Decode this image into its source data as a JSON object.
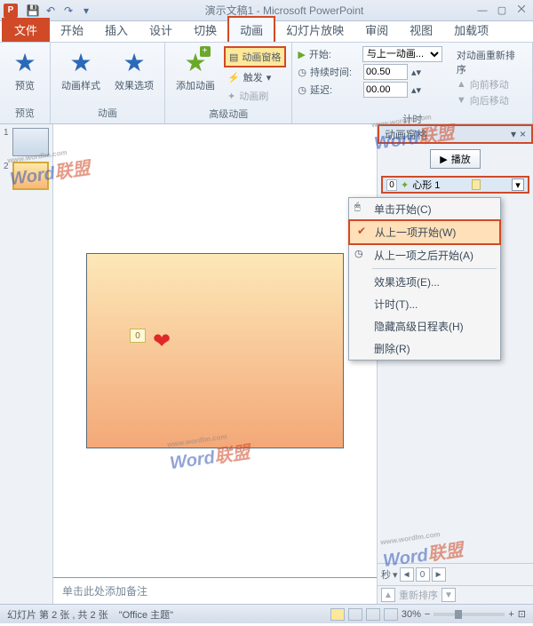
{
  "title": "演示文稿1 - Microsoft PowerPoint",
  "tabs": {
    "file": "文件",
    "home": "开始",
    "insert": "插入",
    "design": "设计",
    "transitions": "切换",
    "animations": "动画",
    "slideshow": "幻灯片放映",
    "review": "审阅",
    "view": "视图",
    "addins": "加载项"
  },
  "ribbon": {
    "preview": "预览",
    "anim_styles": "动画样式",
    "effect_opts": "效果选项",
    "add_anim": "添加动画",
    "anim_pane": "动画窗格",
    "trigger": "触发",
    "anim_painter": "动画刷",
    "start_label": "开始:",
    "start_value": "与上一动画...",
    "duration_label": "持续时间:",
    "duration_value": "00.50",
    "delay_label": "延迟:",
    "delay_value": "00.00",
    "reorder_title": "对动画重新排序",
    "move_earlier": "向前移动",
    "move_later": "向后移动",
    "g_preview": "预览",
    "g_anim": "动画",
    "g_advanced": "高级动画",
    "g_timing": "计时"
  },
  "pane": {
    "title": "动画窗格",
    "play": "播放",
    "item_num": "0",
    "item_name": "心形 1",
    "seconds": "秒",
    "reorder": "重新排序"
  },
  "menu": {
    "on_click": "单击开始(C)",
    "with_prev": "从上一项开始(W)",
    "after_prev": "从上一项之后开始(A)",
    "effect_opts": "效果选项(E)...",
    "timing": "计时(T)...",
    "hide_timeline": "隐藏高级日程表(H)",
    "remove": "删除(R)"
  },
  "slide": {
    "anim_tag": "0",
    "notes_placeholder": "单击此处添加备注"
  },
  "status": {
    "slide_info": "幻灯片 第 2 张 , 共 2 张",
    "theme": "\"Office 主题\"",
    "zoom": "30%"
  },
  "thumbs": [
    "1",
    "2"
  ],
  "watermark": {
    "a": "W",
    "b": "ord",
    "c": "联盟",
    "sub": "www.wordlm.com"
  }
}
